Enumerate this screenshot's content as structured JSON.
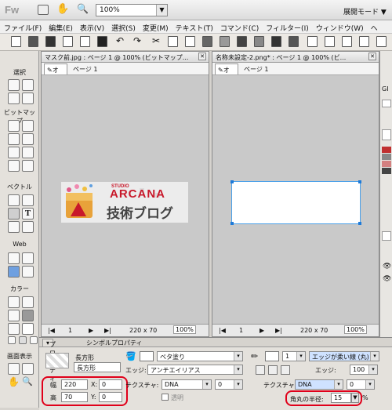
{
  "app": {
    "logo": "Fw",
    "zoom": "100%",
    "mode": "展開モード"
  },
  "menu": [
    "ファイル(F)",
    "編集(E)",
    "表示(V)",
    "選択(S)",
    "変更(M)",
    "テキスト(T)",
    "コマンド(C)",
    "フィルター(I)",
    "ウィンドウ(W)",
    "ヘ"
  ],
  "tools": {
    "select": "選択",
    "bitmap": "ビットマップ",
    "vector": "ベクトル",
    "web": "Web",
    "color": "カラー",
    "view": "画面表示"
  },
  "doc1": {
    "tab": "マスク前.jpg : ページ 1 @ 100% (ビットマップ...",
    "page_tab": "オ",
    "page_label": "ページ 1",
    "page_num": "1",
    "size": "220 x 70",
    "zoom": "100%",
    "logo_studio": "STUDIO",
    "logo_arcana": "ARCANA",
    "logo_blog": "技術ブログ"
  },
  "doc2": {
    "tab": "名称未設定-2.png* : ページ 1 @ 100% (ビ...",
    "page_tab": "オ",
    "page_label": "ページ 1",
    "page_num": "1",
    "size": "220 x 70",
    "zoom": "100%"
  },
  "props": {
    "tab1": "プロパティ",
    "tab2": "シンボルプロパティ",
    "shape_label": "長方形",
    "shape_name": "長方形",
    "w_label": "幅",
    "w": "220",
    "h_label": "高",
    "h": "70",
    "x_label": "X:",
    "x": "0",
    "y_label": "Y:",
    "y": "0",
    "fill": "ベタ塗り",
    "edge_label": "エッジ:",
    "edge": "アンチエイリアス",
    "texture_label": "テクスチャ:",
    "texture": "DNA",
    "texture_val": "0",
    "transparent": "透明",
    "stroke_size": "1",
    "stroke_style": "エッジが柔い線 (丸)",
    "stroke_edge_label": "エッジ:",
    "stroke_edge": "100",
    "stroke_texture_label": "テクスチャ:",
    "stroke_texture": "DNA",
    "stroke_texture_val": "0",
    "radius_label": "角丸の半径:",
    "radius": "15",
    "radius_unit": "%"
  }
}
